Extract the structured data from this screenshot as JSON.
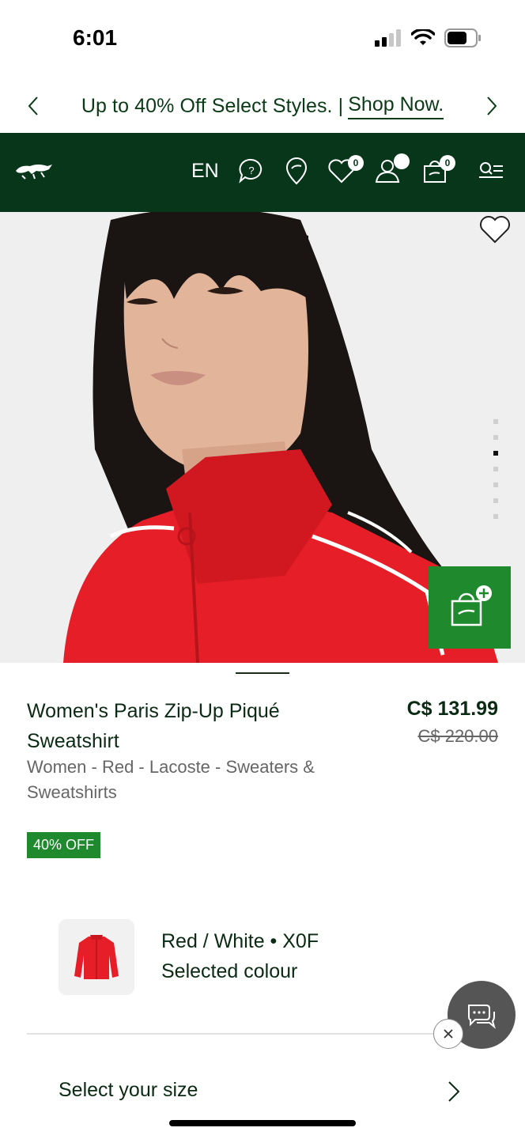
{
  "status_bar": {
    "time": "6:01"
  },
  "promo": {
    "text": "Up to 40% Off Select Styles. |",
    "link": "Shop Now."
  },
  "header": {
    "language": "EN",
    "wishlist_count": "0",
    "bag_count": "0",
    "bg_color": "#07361b"
  },
  "hero": {
    "image_count": 7,
    "active_image_index": 2,
    "add_to_bag_color": "#1f8a2d"
  },
  "product": {
    "title": "Women's Paris Zip-Up Piqué Sweatshirt",
    "category": "Women - Red - Lacoste - Sweaters & Sweatshirts",
    "price": "C$ 131.99",
    "old_price": "C$ 220.00",
    "discount_badge": "40% OFF"
  },
  "colour": {
    "name": "Red / White • X0F",
    "label": "Selected colour"
  },
  "size": {
    "label": "Select your size"
  },
  "icons": [
    "chevron-left-icon",
    "chevron-right-icon",
    "lacoste-logo",
    "help-icon",
    "store-locator-icon",
    "heart-icon",
    "account-icon",
    "bag-icon",
    "search-menu-icon",
    "chat-icon",
    "close-icon"
  ]
}
